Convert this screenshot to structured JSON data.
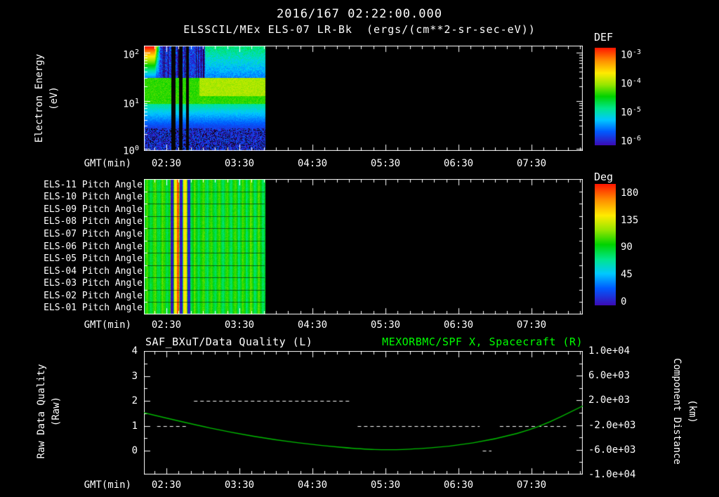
{
  "header": {
    "title": "2016/167 02:22:00.000",
    "subtitle": "ELSSCIL/MEx ELS-07 LR-Bk  (ergs/(cm**2-sr-sec-eV))"
  },
  "colors": {
    "background": "#000000",
    "text": "#ffffff",
    "title_right_green": "#00ff00",
    "curve_green": "#00bb00"
  },
  "time_axis": {
    "label": "GMT(min)",
    "ticks": [
      "02:30",
      "03:30",
      "04:30",
      "05:30",
      "06:30",
      "07:30"
    ]
  },
  "energy_panel": {
    "ylabel_line1": "Electron Energy",
    "ylabel_line2": "(eV)",
    "yticks": [
      {
        "base": "10",
        "exp": "2"
      },
      {
        "base": "10",
        "exp": "1"
      },
      {
        "base": "10",
        "exp": "0"
      }
    ],
    "colorbar": {
      "title": "DEF",
      "ticks": [
        {
          "base": "10",
          "exp": "-3"
        },
        {
          "base": "10",
          "exp": "-4"
        },
        {
          "base": "10",
          "exp": "-5"
        },
        {
          "base": "10",
          "exp": "-6"
        }
      ]
    }
  },
  "pitch_panel": {
    "row_labels": [
      "ELS-11 Pitch Angle",
      "ELS-10 Pitch Angle",
      "ELS-09 Pitch Angle",
      "ELS-08 Pitch Angle",
      "ELS-07 Pitch Angle",
      "ELS-06 Pitch Angle",
      "ELS-05 Pitch Angle",
      "ELS-04 Pitch Angle",
      "ELS-03 Pitch Angle",
      "ELS-02 Pitch Angle",
      "ELS-01 Pitch Angle"
    ],
    "colorbar": {
      "title": "Deg",
      "ticks": [
        "180",
        "135",
        "90",
        "45",
        "0"
      ]
    }
  },
  "quality_panel": {
    "title_left": "SAF_BXuT/Data Quality (L)",
    "title_right": "MEXORBMC/SPF X, Spacecraft (R)",
    "ylabel_left_line1": "Raw Data Quality",
    "ylabel_left_line2": "(Raw)",
    "ylabel_right_line1": "Component Distance",
    "ylabel_right_line2": "(km)",
    "left_ticks": [
      "4",
      "3",
      "2",
      "1",
      "0"
    ],
    "right_ticks": [
      "1.0e+04",
      "6.0e+03",
      "2.0e+03",
      "-2.0e+03",
      "-6.0e+03",
      "-1.0e+04"
    ]
  },
  "chart_data": [
    {
      "type": "heatmap",
      "title": "ELSSCIL/MEx ELS-07 LR-Bk electron energy spectrogram",
      "xlabel": "GMT(min)",
      "x_ticks": [
        "02:30",
        "03:30",
        "04:30",
        "05:30",
        "06:30",
        "07:30"
      ],
      "ylabel": "Electron Energy (eV)",
      "y_scale": "log",
      "y_ticks_eV": [
        1,
        10,
        100
      ],
      "z_label": "DEF",
      "z_units": "ergs/(cm**2-sr-sec-eV)",
      "z_scale": "log",
      "z_ticks": [
        0.001,
        0.0001,
        1e-05,
        1e-06
      ],
      "coverage": {
        "data_start_frac": 0.0,
        "data_end_frac": 0.275,
        "note": "data only from ~02:22 to ~03:50 GMT; black (no data) afterwards"
      },
      "features": [
        "intense red/yellow flux above ~40 eV during first ~10 minutes",
        "persistent bright green band between ~5 and 40 eV",
        "blue/purple speckled low flux below ~3 eV",
        "dark vertical data-gap stripes near 02:45-03:00"
      ],
      "gap_fracs": [
        [
          0.22,
          0.25
        ],
        [
          0.28,
          0.31
        ],
        [
          0.34,
          0.365
        ]
      ]
    },
    {
      "type": "heatmap",
      "title": "ELS pitch angle panels ELS-11 ... ELS-01",
      "rows": 11,
      "z_label": "Deg",
      "z_range": [
        0,
        180
      ],
      "coverage": {
        "data_start_frac": 0.0,
        "data_end_frac": 0.275
      },
      "dominant_value_deg": 100,
      "stripes": [
        {
          "t0": 0.21,
          "t1": 0.235,
          "deg": 20
        },
        {
          "t0": 0.24,
          "t1": 0.262,
          "deg": 140
        },
        {
          "t0": 0.266,
          "t1": 0.282,
          "deg": 170
        },
        {
          "t0": 0.286,
          "t1": 0.312,
          "deg": 20
        },
        {
          "t0": 0.318,
          "t1": 0.345,
          "deg": 140
        },
        {
          "t0": 0.35,
          "t1": 0.375,
          "deg": 25
        }
      ]
    },
    {
      "type": "line",
      "title": "SAF_BXuT/Data Quality (L) and MEXORBMC/SPF X, Spacecraft (R)",
      "xlabel": "GMT(min)",
      "left_axis": {
        "label": "Raw Data Quality (Raw)",
        "range": [
          0,
          4
        ]
      },
      "right_axis": {
        "label": "Component Distance (km)",
        "range": [
          -10000,
          10000
        ]
      },
      "series": [
        {
          "name": "SAF_BXuT/Data Quality (L)",
          "axis": "left",
          "style": "dashed",
          "color": "#ffffff",
          "segments": [
            {
              "x0_frac": 0.03,
              "x1_frac": 0.1,
              "quality": 1
            },
            {
              "x0_frac": 0.114,
              "x1_frac": 0.472,
              "quality": 2
            },
            {
              "x0_frac": 0.487,
              "x1_frac": 0.765,
              "quality": 1
            },
            {
              "x0_frac": 0.772,
              "x1_frac": 0.792,
              "quality": 0
            },
            {
              "x0_frac": 0.811,
              "x1_frac": 0.962,
              "quality": 1
            }
          ]
        },
        {
          "name": "MEXORBMC/SPF X, Spacecraft (R)",
          "axis": "right",
          "style": "solid",
          "color": "#00bb00",
          "points": [
            {
              "x_frac": 0.0,
              "km": 0
            },
            {
              "x_frac": 0.1,
              "km": -1700
            },
            {
              "x_frac": 0.2,
              "km": -3200
            },
            {
              "x_frac": 0.3,
              "km": -4400
            },
            {
              "x_frac": 0.4,
              "km": -5300
            },
            {
              "x_frac": 0.5,
              "km": -5900
            },
            {
              "x_frac": 0.55,
              "km": -6000
            },
            {
              "x_frac": 0.6,
              "km": -5950
            },
            {
              "x_frac": 0.7,
              "km": -5450
            },
            {
              "x_frac": 0.8,
              "km": -4300
            },
            {
              "x_frac": 0.9,
              "km": -2400
            },
            {
              "x_frac": 1.0,
              "km": 1100
            }
          ]
        }
      ]
    }
  ]
}
